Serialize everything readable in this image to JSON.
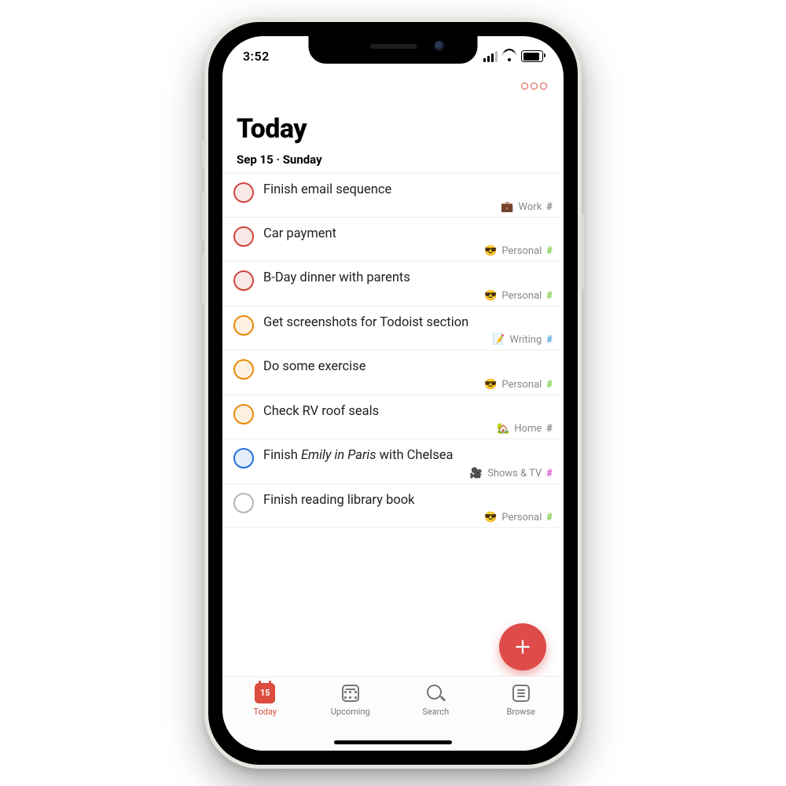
{
  "status": {
    "time": "3:52"
  },
  "header": {
    "title": "Today",
    "date": "Sep 15 · Sunday"
  },
  "today_day_number": "15",
  "tasks": [
    {
      "title": "Finish email sequence",
      "project": "Work",
      "emoji": "💼",
      "hash_color": "#888888",
      "priority": "red"
    },
    {
      "title": "Car payment",
      "project": "Personal",
      "emoji": "😎",
      "hash_color": "#7ecc49",
      "priority": "red"
    },
    {
      "title": "B-Day dinner with parents",
      "project": "Personal",
      "emoji": "😎",
      "hash_color": "#7ecc49",
      "priority": "red"
    },
    {
      "title": "Get screenshots for Todoist section",
      "project": "Writing",
      "emoji": "📝",
      "hash_color": "#4ea8de",
      "priority": "orange"
    },
    {
      "title": "Do some exercise",
      "project": "Personal",
      "emoji": "😎",
      "hash_color": "#7ecc49",
      "priority": "orange"
    },
    {
      "title": "Check RV roof seals",
      "project": "Home",
      "emoji": "🏡",
      "hash_color": "#888888",
      "priority": "orange"
    },
    {
      "title_html": "Finish <em>Emily in Paris</em> with Chelsea",
      "project": "Shows & TV",
      "emoji": "🎥",
      "hash_color": "#d356d3",
      "priority": "blue"
    },
    {
      "title": "Finish reading library book",
      "project": "Personal",
      "emoji": "😎",
      "hash_color": "#7ecc49",
      "priority": "gray"
    }
  ],
  "tabs": [
    {
      "id": "today",
      "label": "Today",
      "active": true
    },
    {
      "id": "upcoming",
      "label": "Upcoming",
      "active": false
    },
    {
      "id": "search",
      "label": "Search",
      "active": false
    },
    {
      "id": "browse",
      "label": "Browse",
      "active": false
    }
  ],
  "colors": {
    "accent": "#db4c3f"
  }
}
